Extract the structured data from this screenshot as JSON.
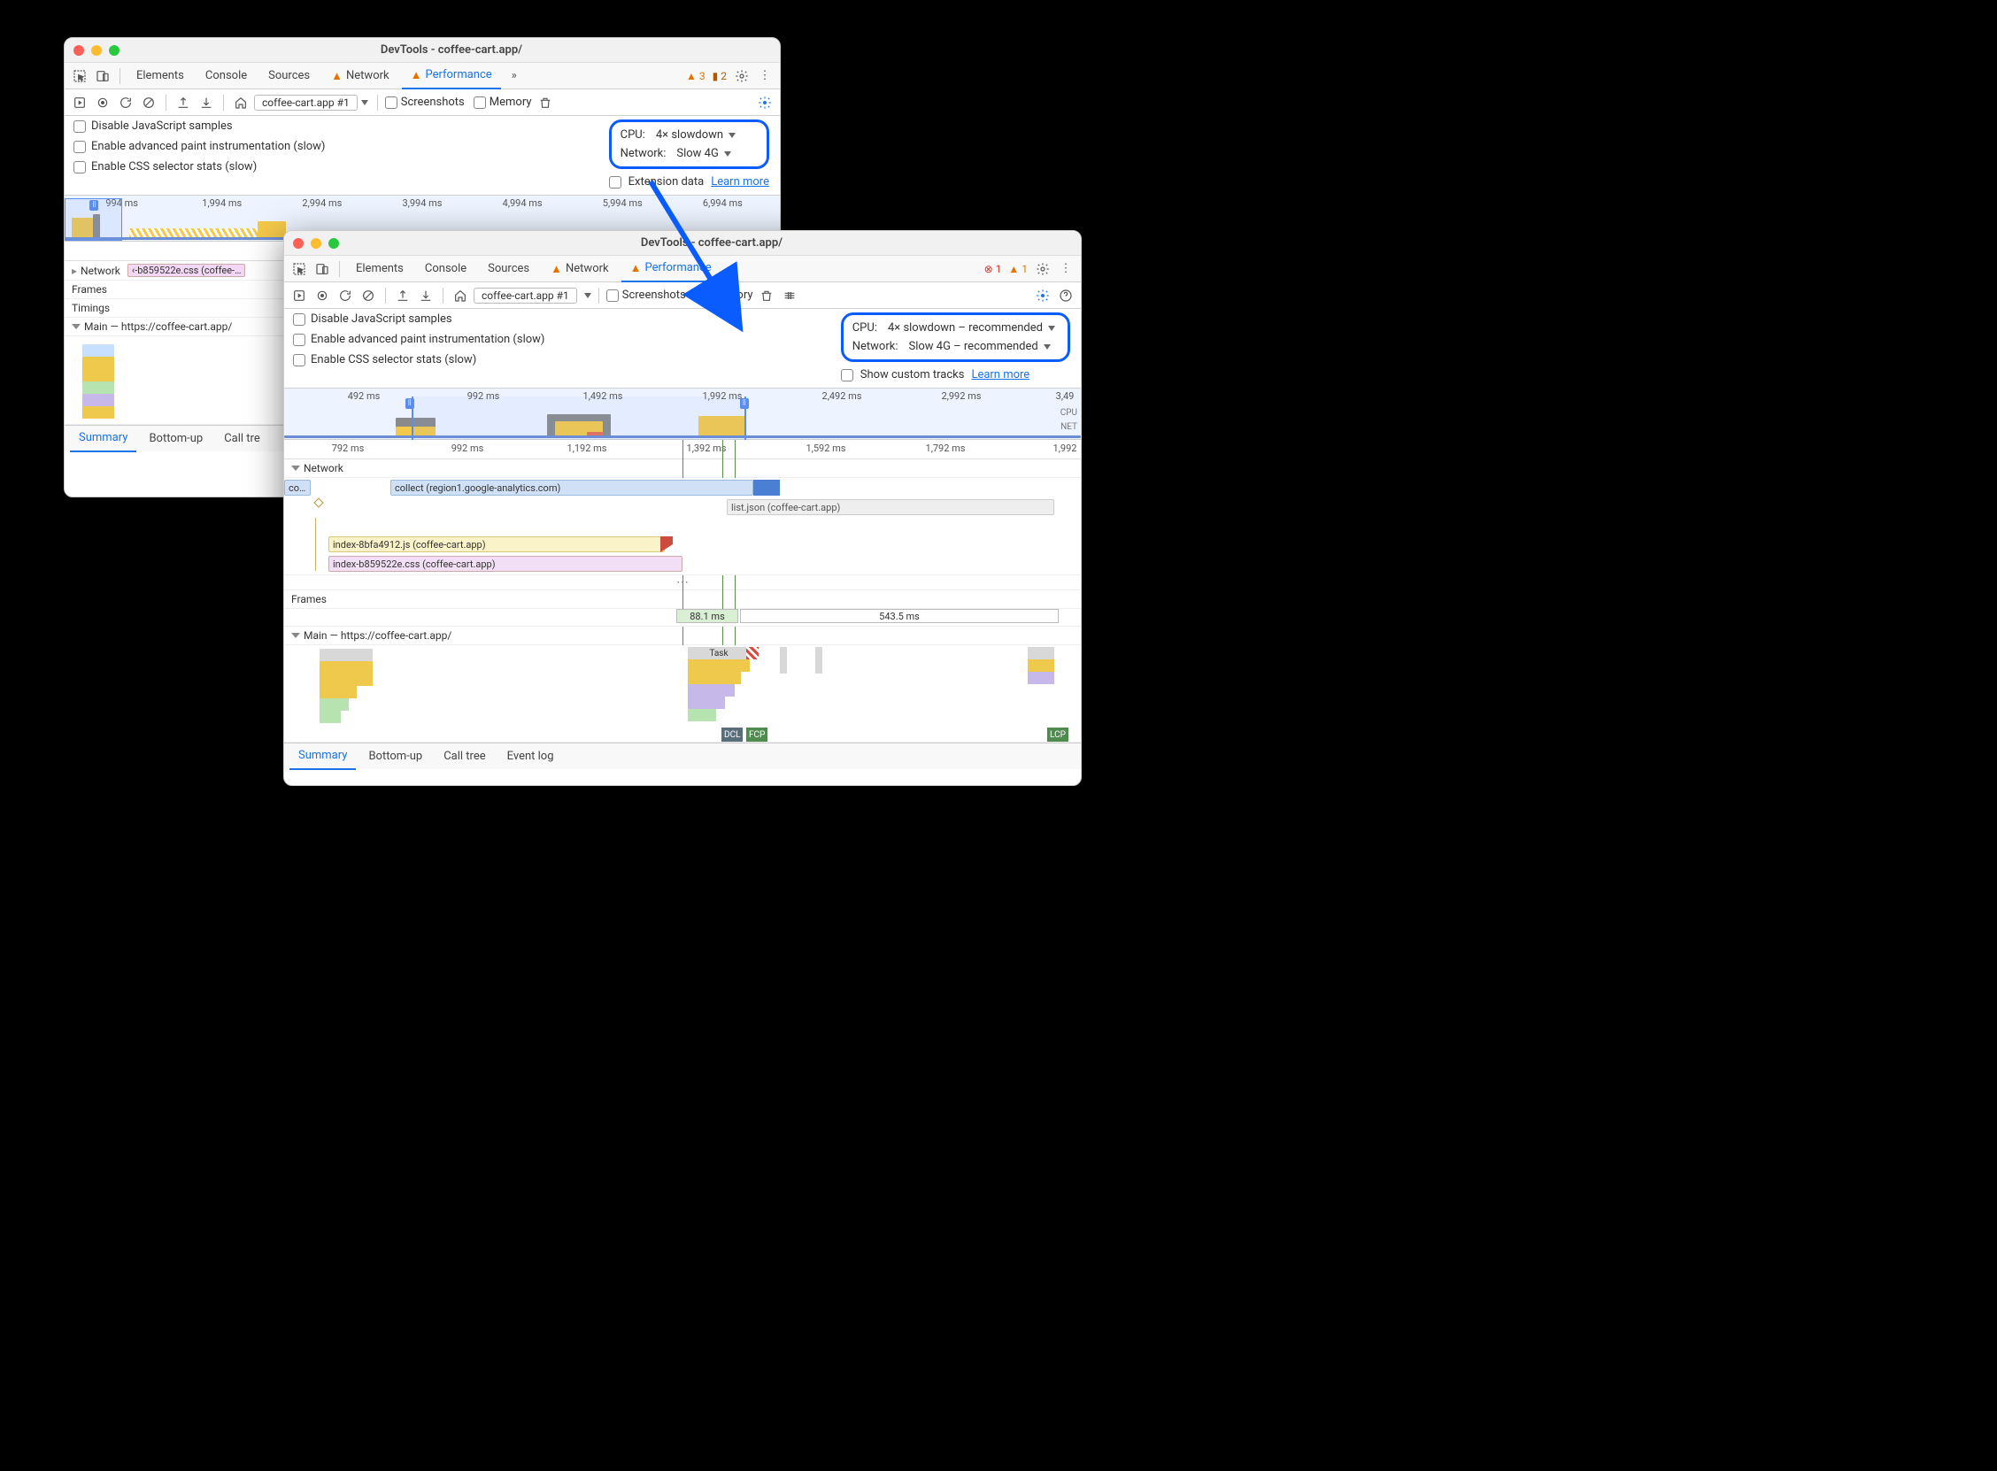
{
  "windowA": {
    "title": "DevTools - coffee-cart.app/",
    "tabs": [
      "Elements",
      "Console",
      "Sources",
      "Network",
      "Performance"
    ],
    "active_tab": "Performance",
    "warn_count": "3",
    "info_count": "2",
    "recording_select": "coffee-cart.app #1",
    "screenshots_label": "Screenshots",
    "memory_label": "Memory",
    "settings": {
      "disable_js": "Disable JavaScript samples",
      "adv_paint": "Enable advanced paint instrumentation (slow)",
      "css_stats": "Enable CSS selector stats (slow)",
      "cpu_label": "CPU:",
      "cpu_value": "4× slowdown",
      "net_label": "Network:",
      "net_value": "Slow 4G",
      "ext_label": "Extension data",
      "learn_more": "Learn more"
    },
    "ts": [
      "994 ms",
      "1,994 ms",
      "2,994 ms",
      "3,994 ms",
      "4,994 ms",
      "5,994 ms",
      "6,994 ms"
    ],
    "ruler_label": "994 ms",
    "network_track": "Network",
    "network_item": "‹-b859522e.css (coffee-…",
    "frames_track": "Frames",
    "timings_track": "Timings",
    "main_track": "Main — https://coffee-cart.app/",
    "bottom_tabs": [
      "Summary",
      "Bottom-up",
      "Call tre"
    ]
  },
  "windowB": {
    "title": "DevTools - coffee-cart.app/",
    "tabs": [
      "Elements",
      "Console",
      "Sources",
      "Network",
      "Performance"
    ],
    "active_tab": "Performance",
    "err_count": "1",
    "warn_count": "1",
    "recording_select": "coffee-cart.app #1",
    "screenshots_label": "Screenshots",
    "memory_label": "Memory",
    "settings": {
      "disable_js": "Disable JavaScript samples",
      "adv_paint": "Enable advanced paint instrumentation (slow)",
      "css_stats": "Enable CSS selector stats (slow)",
      "cpu_label": "CPU:",
      "cpu_value": "4× slowdown – recommended",
      "net_label": "Network:",
      "net_value": "Slow 4G – recommended",
      "custom_tracks": "Show custom tracks",
      "learn_more": "Learn more"
    },
    "ts": [
      "492 ms",
      "992 ms",
      "1,492 ms",
      "1,992 ms",
      "2,492 ms",
      "2,992 ms",
      "3,49"
    ],
    "ts_cpu": "CPU",
    "ts_net": "NET",
    "ruler": [
      "792 ms",
      "992 ms",
      "1,192 ms",
      "1,392 ms",
      "1,592 ms",
      "1,792 ms",
      "1,992"
    ],
    "network_track": "Network",
    "net_items": {
      "co": "co…",
      "collect": "collect (region1.google-analytics.com)",
      "list": "list.json (coffee-cart.app)",
      "indexjs": "index-8bfa4912.js (coffee-cart.app)",
      "indexcss": "index-b859522e.css (coffee-cart.app)"
    },
    "frames_track": "Frames",
    "frames": [
      "88.1 ms",
      "543.5 ms"
    ],
    "main_track": "Main — https://coffee-cart.app/",
    "task_label": "Task",
    "markers": {
      "dcl": "DCL",
      "fcp": "FCP",
      "lcp": "LCP"
    },
    "bottom_tabs": [
      "Summary",
      "Bottom-up",
      "Call tree",
      "Event log"
    ]
  }
}
